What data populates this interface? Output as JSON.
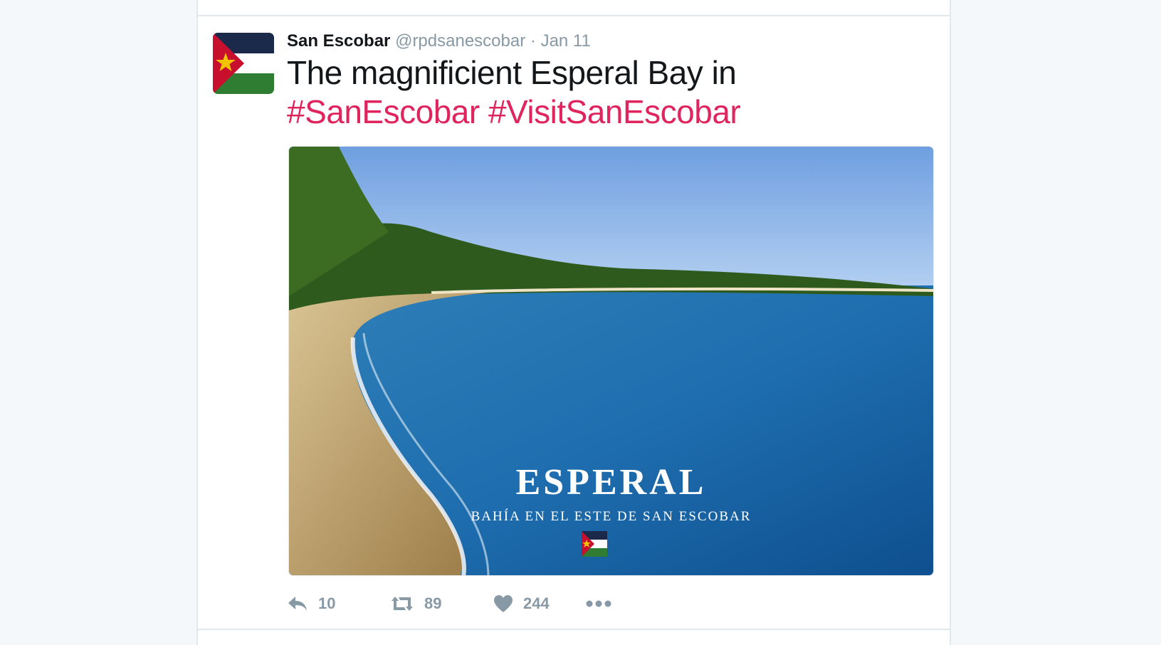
{
  "tweet": {
    "name": "San Escobar",
    "handle": "@rpdsanescobar",
    "separator": "·",
    "date": "Jan 11",
    "text": "The magnificient Esperal Bay in ",
    "hashtag1": "#SanEscobar",
    "hashtag2": "#VisitSanEscobar",
    "media": {
      "title": "ESPERAL",
      "subtitle": "BAHÍA EN EL ESTE DE SAN ESCOBAR"
    },
    "actions": {
      "reply_count": "10",
      "retweet_count": "89",
      "like_count": "244"
    }
  },
  "colors": {
    "hashtag": "#e0245e",
    "muted": "#8899a6",
    "flag_navy": "#1b2a4a",
    "flag_red": "#c8102e",
    "flag_green": "#2e7d32",
    "flag_star": "#f2c300"
  },
  "icons": [
    "reply-icon",
    "retweet-icon",
    "heart-icon",
    "more-icon"
  ]
}
